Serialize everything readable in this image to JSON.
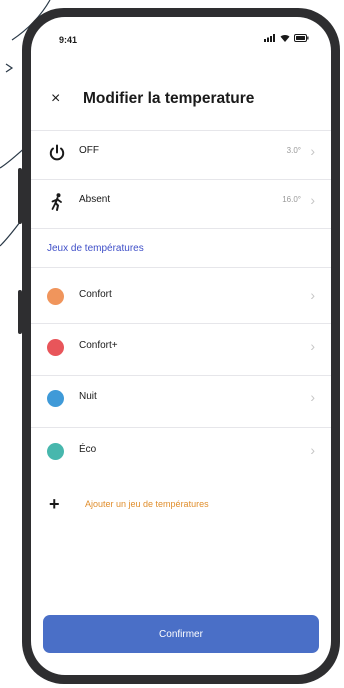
{
  "status_bar": {
    "time": "9:41"
  },
  "header": {
    "close_glyph": "×",
    "title": "Modifier la temperature"
  },
  "modes": [
    {
      "label": "OFF",
      "value": "3.0°",
      "icon": "power-icon"
    },
    {
      "label": "Absent",
      "value": "16.0°",
      "icon": "walking-person-icon"
    }
  ],
  "presets_section": {
    "title": "Jeux de températures",
    "items": [
      {
        "label": "Confort",
        "color": "#f0955c"
      },
      {
        "label": "Confort+",
        "color": "#e8555a"
      },
      {
        "label": "Nuit",
        "color": "#3f9ad8"
      },
      {
        "label": "Éco",
        "color": "#47b7ad"
      }
    ]
  },
  "add_preset": {
    "icon": "plus-icon",
    "label": "Ajouter un jeu de températures"
  },
  "confirm_button": {
    "label": "Confirmer"
  },
  "colors": {
    "accent": "#3f4fc8",
    "confirm_bg": "#4a6fc7",
    "add_link": "#e08e2c",
    "frame": "#2e2e30"
  }
}
